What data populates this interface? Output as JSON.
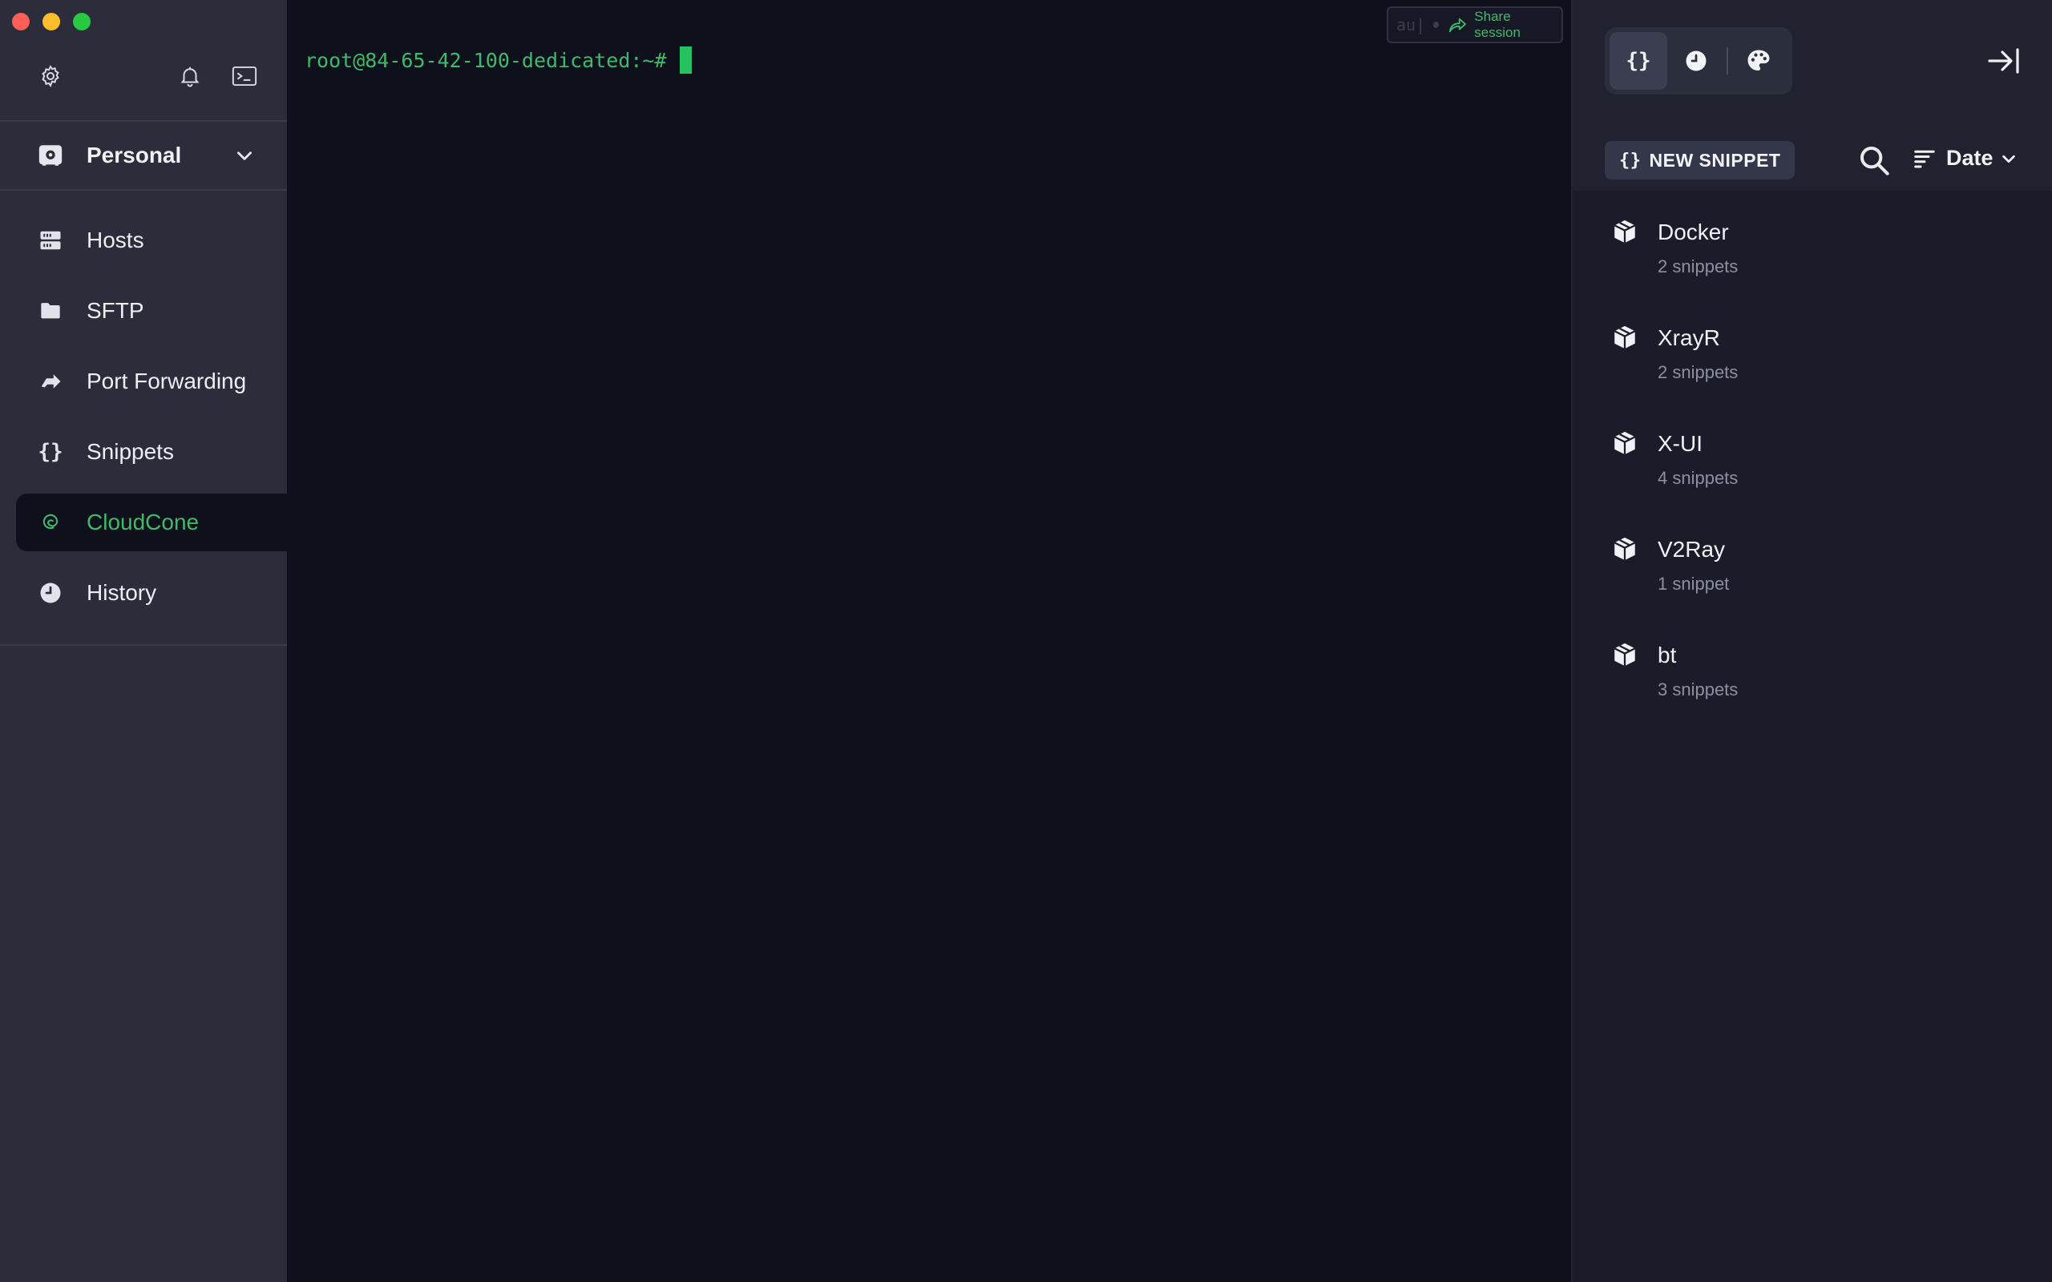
{
  "window": {
    "controls": [
      "close",
      "minimize",
      "maximize"
    ]
  },
  "sidebar": {
    "top_icons": [
      "gear-icon",
      "bell-icon",
      "terminal-icon"
    ],
    "vault": {
      "name": "Personal",
      "icon": "vault-icon"
    },
    "items": [
      {
        "label": "Hosts",
        "icon": "server-icon"
      },
      {
        "label": "SFTP",
        "icon": "folder-icon"
      },
      {
        "label": "Port Forwarding",
        "icon": "forward-arrow-icon"
      },
      {
        "label": "Snippets",
        "icon": "braces-icon",
        "glyph": "{}"
      },
      {
        "label": "CloudCone",
        "icon": "debian-swirl-icon",
        "active": true
      },
      {
        "label": "History",
        "icon": "clock-icon"
      }
    ]
  },
  "terminal": {
    "prompt": "root@84-65-42-100-dedicated:~#",
    "share": {
      "placeholder": "au|",
      "label": "Share session"
    }
  },
  "panel": {
    "tabs": [
      {
        "icon": "braces-icon",
        "glyph": "{}",
        "active": true
      },
      {
        "icon": "clock-icon"
      },
      {
        "icon": "palette-icon"
      }
    ],
    "new_snippet_label": "NEW SNIPPET",
    "new_snippet_glyph": "{}",
    "sort_label": "Date",
    "packages": [
      {
        "name": "Docker",
        "count": "2 snippets"
      },
      {
        "name": "XrayR",
        "count": "2 snippets"
      },
      {
        "name": "X-UI",
        "count": "4 snippets"
      },
      {
        "name": "V2Ray",
        "count": "1 snippet"
      },
      {
        "name": "bt",
        "count": "3 snippets"
      }
    ]
  },
  "colors": {
    "accent": "#3fba6b",
    "sidebar_bg": "#2b2d3a",
    "terminal_bg": "#0e101b",
    "panel_bg": "#1a1c29"
  }
}
